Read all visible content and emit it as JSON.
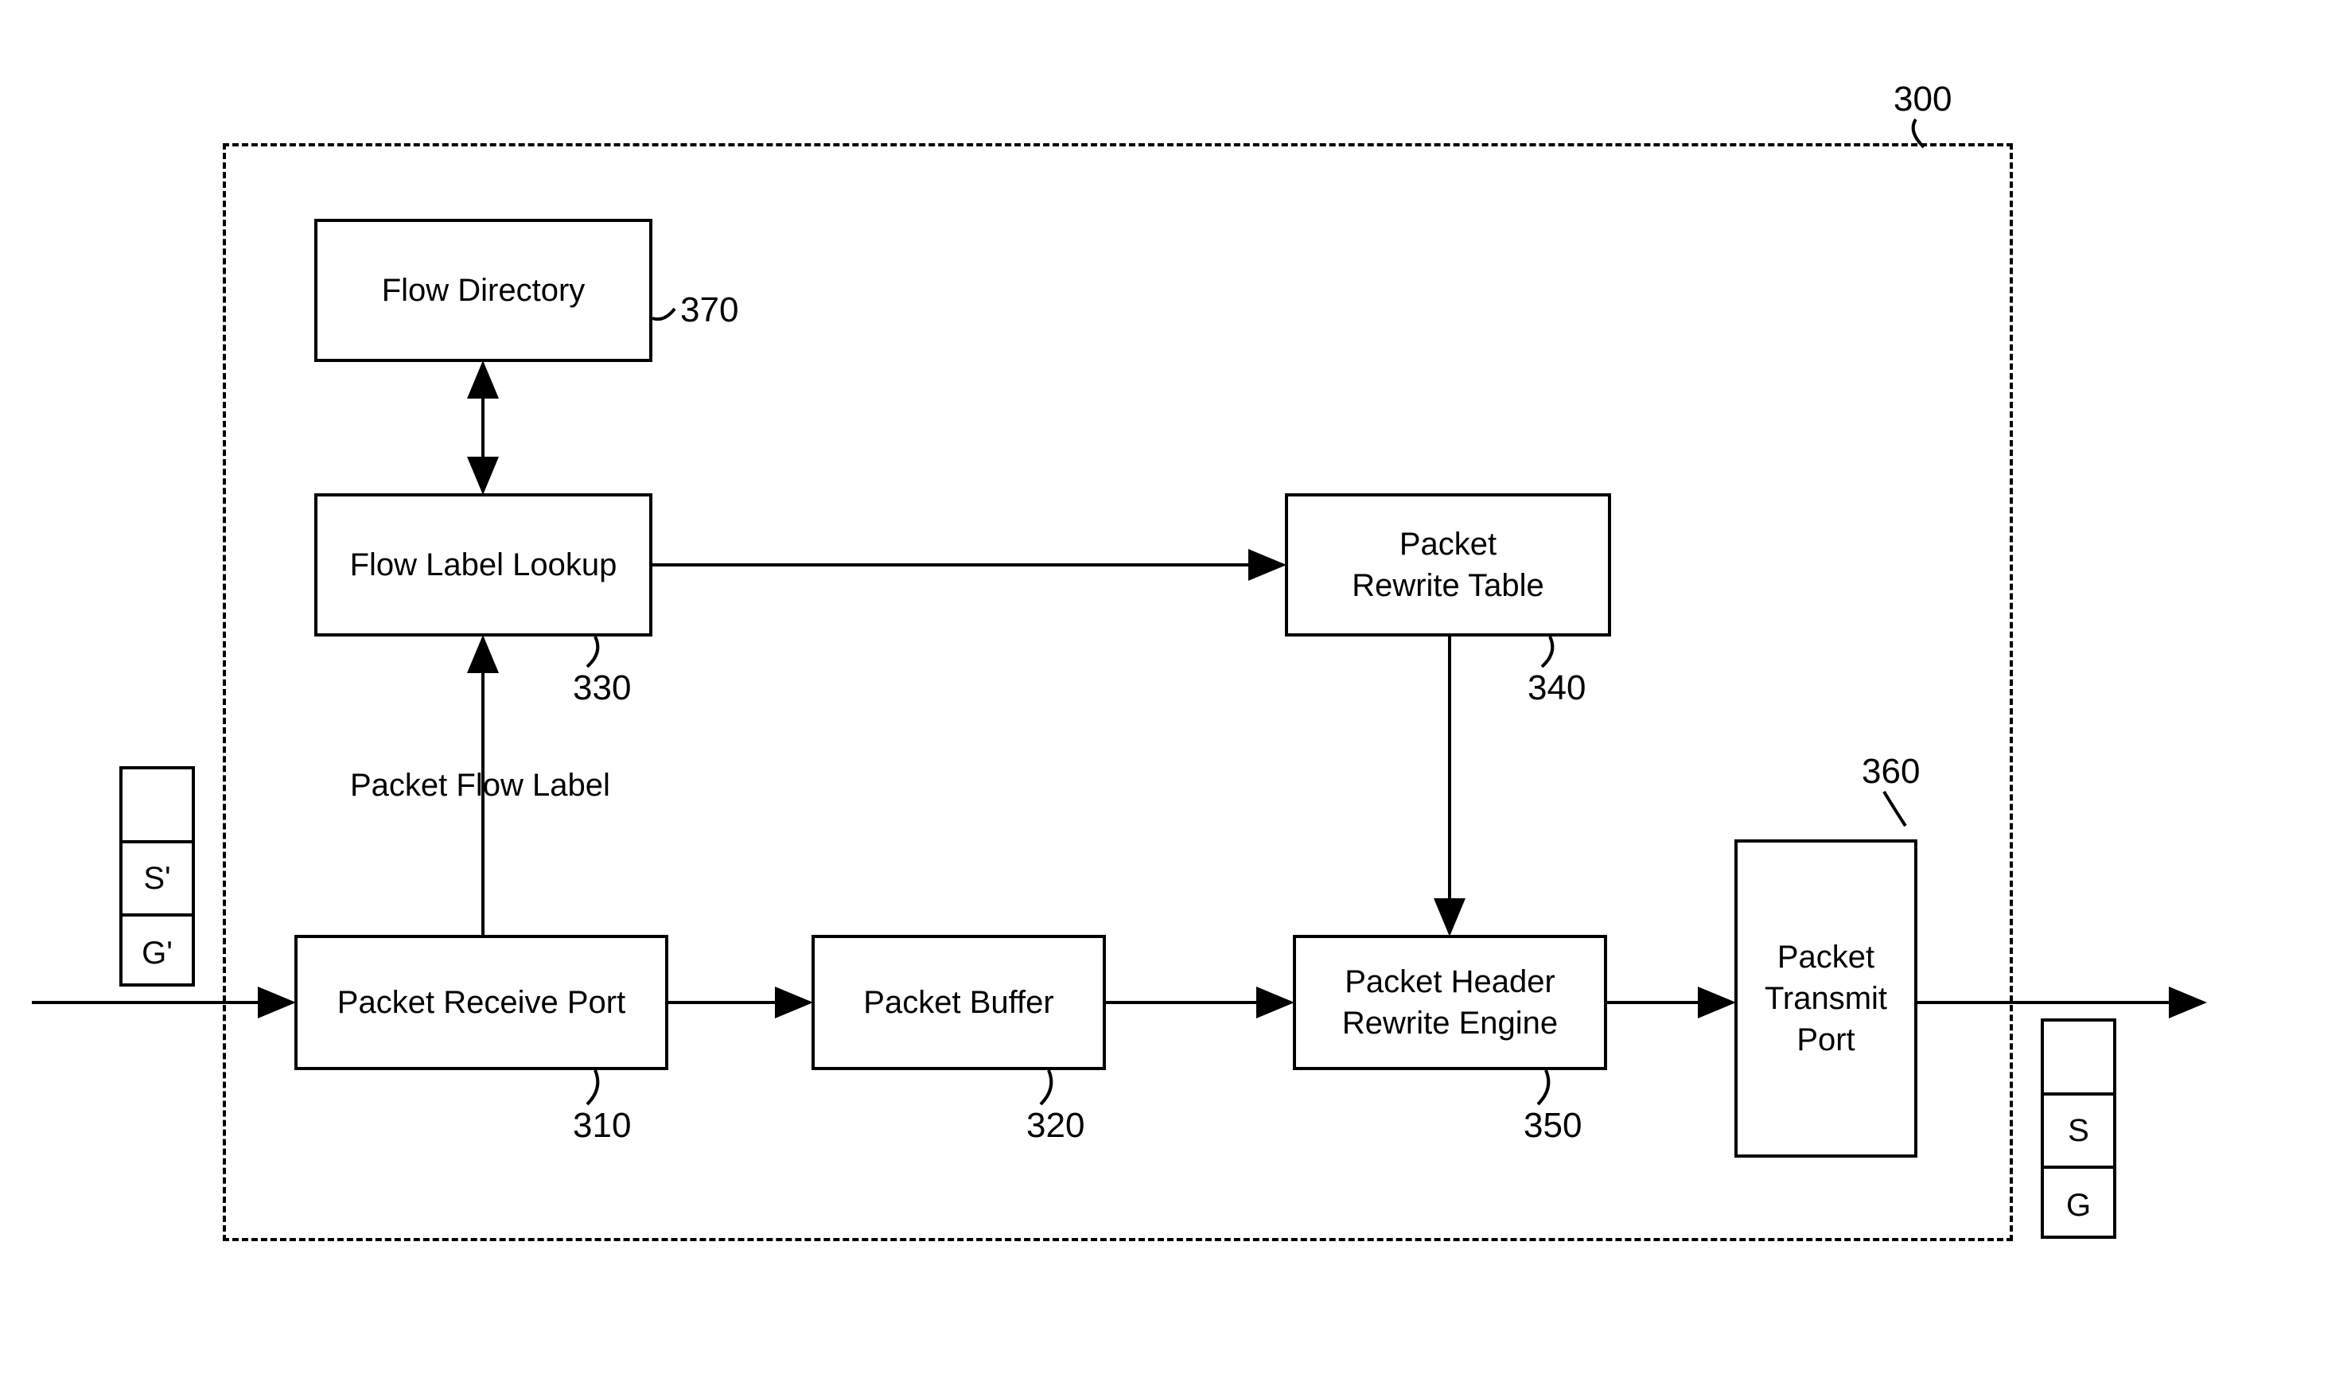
{
  "container_ref": "300",
  "boxes": {
    "flow_directory": {
      "label": "Flow Directory",
      "ref": "370"
    },
    "flow_label_lookup": {
      "label": "Flow Label Lookup",
      "ref": "330"
    },
    "packet_rewrite_table": {
      "label": "Packet\nRewrite Table",
      "ref": "340"
    },
    "packet_receive_port": {
      "label": "Packet Receive Port",
      "ref": "310"
    },
    "packet_buffer": {
      "label": "Packet Buffer",
      "ref": "320"
    },
    "packet_header_rewrite_engine": {
      "label": "Packet Header\nRewrite Engine",
      "ref": "350"
    },
    "packet_transmit_port": {
      "label": "Packet\nTransmit\nPort",
      "ref": "360"
    }
  },
  "edge_labels": {
    "packet_flow_label": "Packet Flow Label"
  },
  "input_packet": {
    "top": "",
    "mid": "S'",
    "bot": "G'"
  },
  "output_packet": {
    "top": "",
    "mid": "S",
    "bot": "G"
  }
}
